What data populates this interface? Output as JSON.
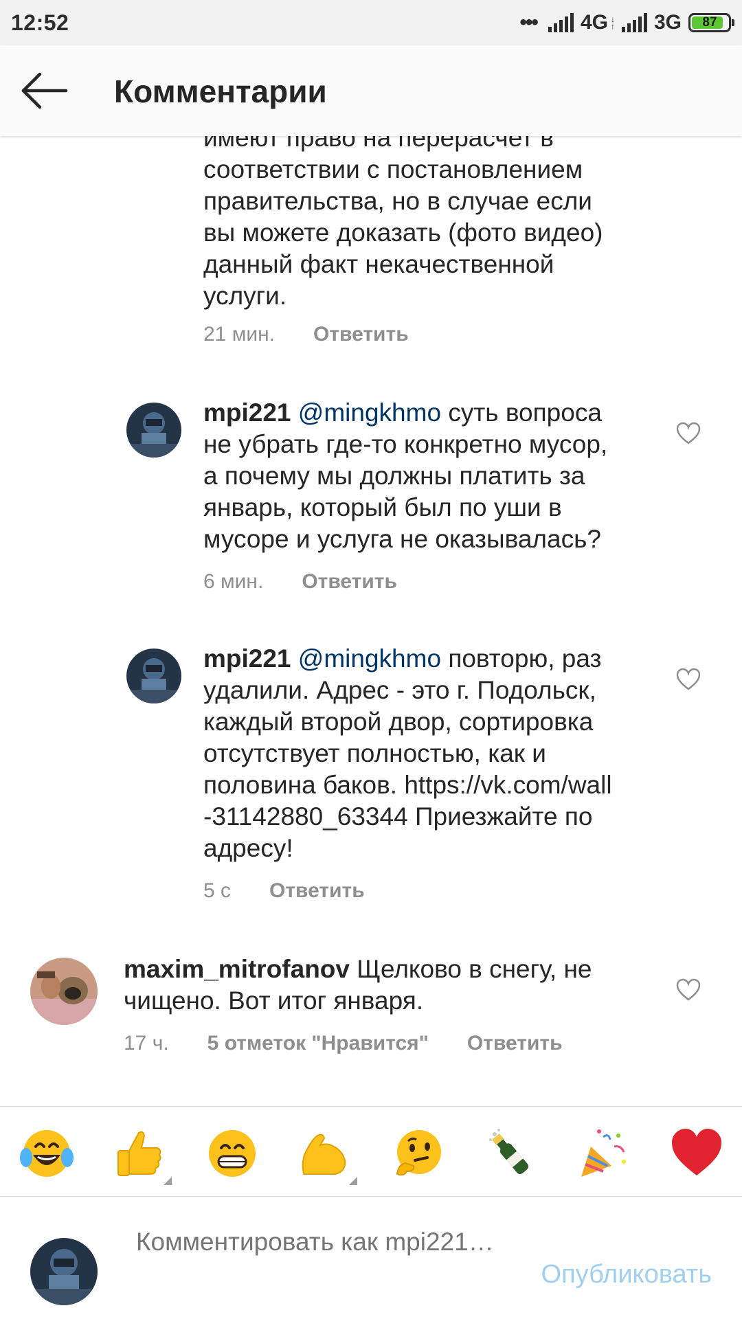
{
  "status_bar": {
    "time": "12:52",
    "network1": "4G",
    "network2": "3G",
    "battery": "87"
  },
  "header": {
    "title": "Комментарии",
    "back_icon": "arrow-left-icon"
  },
  "comments": [
    {
      "text_lines": [
        "имеют право на перерасчет в",
        "соответствии с постановлением",
        "правительства, но в случае если",
        "вы можете доказать (фото видео)",
        "данный факт некачественной",
        "услуги."
      ],
      "time": "21 мин.",
      "reply": "Ответить"
    },
    {
      "username": "mpi221",
      "mention": "@mingkhmo",
      "text_first": "суть вопроса",
      "text_lines": [
        "не убрать где-то конкретно мусор,",
        "а почему мы должны платить за",
        "январь, который был по уши в",
        "мусоре и услуга не оказывалась?"
      ],
      "time": "6 мин.",
      "reply": "Ответить"
    },
    {
      "username": "mpi221",
      "mention": "@mingkhmo",
      "text_first": "повторю, раз",
      "text_lines": [
        "удалили. Адрес - это г. Подольск,",
        "каждый второй двор, сортировка",
        "отсутствует полностью, как и",
        "половина баков. https://vk.com/wall",
        "-31142880_63344 Приезжайте по",
        "адресу!"
      ],
      "time": "5 с",
      "reply": "Ответить"
    },
    {
      "username": "maxim_mitrofanov",
      "text_first": "Щелково в снегу, не",
      "text_lines": [
        "чищено. Вот итог января."
      ],
      "time": "17 ч.",
      "likes": "5 отметок \"Нравится\"",
      "reply": "Ответить"
    }
  ],
  "emoji_bar": {
    "items": [
      "😂",
      "👍",
      "😁",
      "💪",
      "🤔",
      "🍾",
      "🎉",
      "❤️"
    ]
  },
  "composer": {
    "placeholder": "Комментировать как mpi221…",
    "publish": "Опубликовать"
  },
  "colors": {
    "mention": "#003569",
    "meta": "#8e8e8e",
    "publish_disabled": "#9fcff1",
    "battery_fill": "#5cc634"
  }
}
